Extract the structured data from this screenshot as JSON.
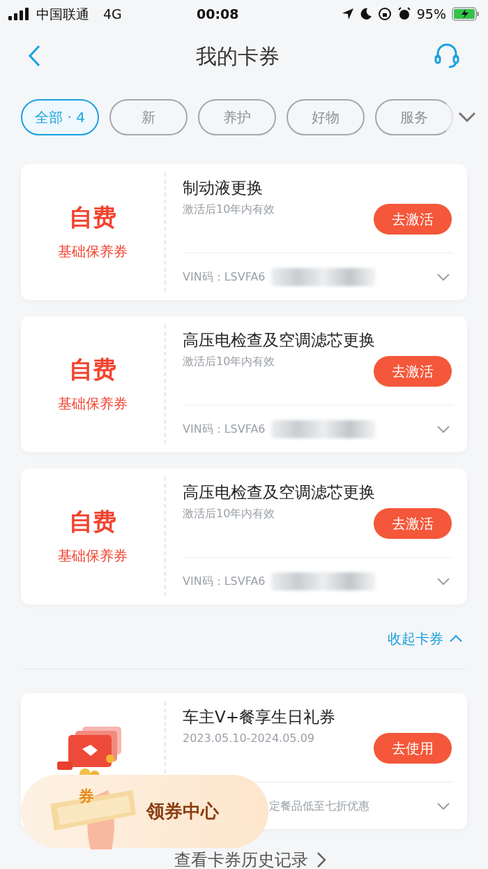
{
  "status_bar": {
    "carrier": "中国联通",
    "network": "4G",
    "time": "00:08",
    "battery": "95%"
  },
  "header": {
    "title": "我的卡券"
  },
  "filters": [
    {
      "label": "全部 · 4",
      "selected": true
    },
    {
      "label": "新",
      "selected": false
    },
    {
      "label": "养护",
      "selected": false
    },
    {
      "label": "好物",
      "selected": false
    },
    {
      "label": "服务",
      "selected": false
    }
  ],
  "coupons": [
    {
      "kind": "maintenance",
      "price": "自费",
      "type": "基础保养券",
      "title": "制动液更换",
      "validity": "激活后10年内有效",
      "button": "去激活",
      "footer": "VIN码：LSVFA6"
    },
    {
      "kind": "maintenance",
      "price": "自费",
      "type": "基础保养券",
      "title": "高压电检查及空调滤芯更换",
      "validity": "激活后10年内有效",
      "button": "去激活",
      "footer": "VIN码：LSVFA6"
    },
    {
      "kind": "maintenance",
      "price": "自费",
      "type": "基础保养券",
      "title": "高压电检查及空调滤芯更换",
      "validity": "激活后10年内有效",
      "button": "去激活",
      "footer": "VIN码：LSVFA6"
    }
  ],
  "collapse_link": "收起卡券",
  "other_coupons": [
    {
      "kind": "gift",
      "title": "车主V+餐享生日礼券",
      "validity": "2023.05.10-2024.05.09",
      "button": "去使用",
      "footer": "定餐品低至七折优惠"
    }
  ],
  "floating_badge": {
    "stamp": "券",
    "label": "领券中心"
  },
  "history_link": "查看卡券历史记录"
}
